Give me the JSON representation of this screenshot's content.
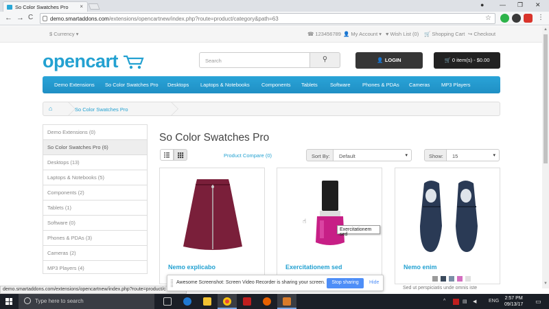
{
  "browser": {
    "tab_title": "So Color Swatches Pro",
    "tab_close": "×",
    "url_host": "demo.smartaddons.com",
    "url_path": "/extensions/opencartnew/index.php?route=product/category&path=63",
    "back": "←",
    "forward": "→",
    "reload": "C",
    "bookmark": "☆",
    "minimize": "—",
    "maximize": "❐",
    "close": "✕"
  },
  "topbar": {
    "currency": "$ Currency ▾",
    "phone": "☎ 123456789",
    "my_account": "👤 My Account ▾",
    "wishlist": "♥ Wish List (0)",
    "shopping_cart": "🛒 Shopping Cart",
    "checkout": "↪ Checkout"
  },
  "header": {
    "logo": "opencart",
    "search_placeholder": "Search",
    "search_icon": "⚲",
    "login_label": "👤 LOGIN",
    "cart_label": "🛒 0 item(s) - $0.00"
  },
  "menu": [
    "Demo Extensions",
    "So Color Swatches Pro",
    "Desktops",
    "Laptops & Notebooks",
    "Components",
    "Tablets",
    "Software",
    "Phones & PDAs",
    "Cameras",
    "MP3 Players"
  ],
  "breadcrumb": {
    "home_icon": "⌂",
    "current": "So Color Swatches Pro"
  },
  "sidebar": [
    {
      "label": "Demo Extensions (0)",
      "active": false
    },
    {
      "label": "So Color Swatches Pro (6)",
      "active": true
    },
    {
      "label": "Desktops (13)",
      "active": false
    },
    {
      "label": "Laptops & Notebooks (5)",
      "active": false
    },
    {
      "label": "Components (2)",
      "active": false
    },
    {
      "label": "Tablets (1)",
      "active": false
    },
    {
      "label": "Software (0)",
      "active": false
    },
    {
      "label": "Phones & PDAs (3)",
      "active": false
    },
    {
      "label": "Cameras (2)",
      "active": false
    },
    {
      "label": "MP3 Players (4)",
      "active": false
    }
  ],
  "content": {
    "title": "So Color Swatches Pro",
    "product_compare": "Product Compare (0)",
    "sort_by_label": "Sort By:",
    "sort_by_value": "Default",
    "show_label": "Show:",
    "show_value": "15",
    "caret": "▾"
  },
  "products": [
    {
      "name": "Nemo explicabo",
      "swatches": [
        "#d7d7d7",
        "#b6c6cf",
        "#c2e0d5"
      ]
    },
    {
      "name": "Exercitationem sed",
      "swatches": []
    },
    {
      "name": "Nemo enim",
      "swatches": [
        "#9a9a9a",
        "#3b4a5c",
        "#7a8ea6",
        "#d36ec0",
        "#e0e0e0"
      ],
      "description": "Sed ut perspiciatis unde omnis iste"
    }
  ],
  "tooltip": "Exercitationem sed",
  "status_url": "demo.smartaddons.com/extensions/opencartnew/index.php?route=product/c",
  "share_bar": {
    "message": "Awesome Screenshot: Screen Video Recorder is sharing your screen.",
    "stop": "Stop sharing",
    "hide": "Hide"
  },
  "taskbar": {
    "search": "Type here to search",
    "lang": "ENG",
    "time": "2:57 PM",
    "date": "09/13/17",
    "tray_up": "^"
  },
  "colors": {
    "accent": "#23a1d1",
    "menu": "#229ad2"
  }
}
